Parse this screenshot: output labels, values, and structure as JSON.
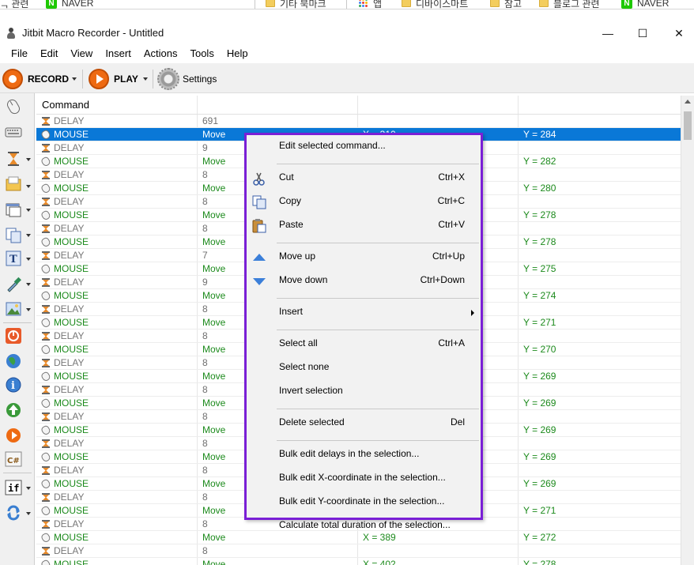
{
  "bookmarks": {
    "left": [
      {
        "label": "ᆨ 관련",
        "type": "text"
      },
      {
        "label": "NAVER",
        "type": "naver"
      },
      {
        "label": "기타 북마크",
        "type": "folder"
      }
    ],
    "right": [
      {
        "label": "앱",
        "type": "apps"
      },
      {
        "label": "디바이스마트",
        "type": "folder"
      },
      {
        "label": "참고",
        "type": "folder"
      },
      {
        "label": "블로그 관련",
        "type": "folder"
      },
      {
        "label": "NAVER",
        "type": "naver"
      }
    ]
  },
  "window": {
    "title": "Jitbit Macro Recorder - Untitled",
    "minimize": "—",
    "maximize": "☐",
    "close": "✕"
  },
  "menu": [
    "File",
    "Edit",
    "View",
    "Insert",
    "Actions",
    "Tools",
    "Help"
  ],
  "toolbar": {
    "record_label": "RECORD",
    "play_label": "PLAY",
    "settings_label": "Settings"
  },
  "grid": {
    "header": "Command",
    "rows": [
      {
        "type": "DELAY",
        "c1": "691",
        "c2": "",
        "c3": ""
      },
      {
        "type": "MOUSE",
        "c1": "Move",
        "c2": "X = 310",
        "c3": "Y = 284",
        "selected": true
      },
      {
        "type": "DELAY",
        "c1": "9",
        "c2": "",
        "c3": ""
      },
      {
        "type": "MOUSE",
        "c1": "Move",
        "c2": "",
        "c3": "Y = 282"
      },
      {
        "type": "DELAY",
        "c1": "8",
        "c2": "",
        "c3": ""
      },
      {
        "type": "MOUSE",
        "c1": "Move",
        "c2": "",
        "c3": "Y = 280"
      },
      {
        "type": "DELAY",
        "c1": "8",
        "c2": "",
        "c3": ""
      },
      {
        "type": "MOUSE",
        "c1": "Move",
        "c2": "",
        "c3": "Y = 278"
      },
      {
        "type": "DELAY",
        "c1": "8",
        "c2": "",
        "c3": ""
      },
      {
        "type": "MOUSE",
        "c1": "Move",
        "c2": "",
        "c3": "Y = 278"
      },
      {
        "type": "DELAY",
        "c1": "7",
        "c2": "",
        "c3": ""
      },
      {
        "type": "MOUSE",
        "c1": "Move",
        "c2": "",
        "c3": "Y = 275"
      },
      {
        "type": "DELAY",
        "c1": "9",
        "c2": "",
        "c3": ""
      },
      {
        "type": "MOUSE",
        "c1": "Move",
        "c2": "",
        "c3": "Y = 274"
      },
      {
        "type": "DELAY",
        "c1": "8",
        "c2": "",
        "c3": ""
      },
      {
        "type": "MOUSE",
        "c1": "Move",
        "c2": "",
        "c3": "Y = 271"
      },
      {
        "type": "DELAY",
        "c1": "8",
        "c2": "",
        "c3": ""
      },
      {
        "type": "MOUSE",
        "c1": "Move",
        "c2": "",
        "c3": "Y = 270"
      },
      {
        "type": "DELAY",
        "c1": "8",
        "c2": "",
        "c3": ""
      },
      {
        "type": "MOUSE",
        "c1": "Move",
        "c2": "",
        "c3": "Y = 269"
      },
      {
        "type": "DELAY",
        "c1": "8",
        "c2": "",
        "c3": ""
      },
      {
        "type": "MOUSE",
        "c1": "Move",
        "c2": "",
        "c3": "Y = 269"
      },
      {
        "type": "DELAY",
        "c1": "8",
        "c2": "",
        "c3": ""
      },
      {
        "type": "MOUSE",
        "c1": "Move",
        "c2": "",
        "c3": "Y = 269"
      },
      {
        "type": "DELAY",
        "c1": "8",
        "c2": "",
        "c3": ""
      },
      {
        "type": "MOUSE",
        "c1": "Move",
        "c2": "",
        "c3": "Y = 269"
      },
      {
        "type": "DELAY",
        "c1": "8",
        "c2": "",
        "c3": ""
      },
      {
        "type": "MOUSE",
        "c1": "Move",
        "c2": "",
        "c3": "Y = 269"
      },
      {
        "type": "DELAY",
        "c1": "8",
        "c2": "",
        "c3": ""
      },
      {
        "type": "MOUSE",
        "c1": "Move",
        "c2": "",
        "c3": "Y = 271"
      },
      {
        "type": "DELAY",
        "c1": "8",
        "c2": "",
        "c3": ""
      },
      {
        "type": "MOUSE",
        "c1": "Move",
        "c2": "X = 389",
        "c3": "Y = 272"
      },
      {
        "type": "DELAY",
        "c1": "8",
        "c2": "",
        "c3": ""
      },
      {
        "type": "MOUSE",
        "c1": "Move",
        "c2": "X = 402",
        "c3": "Y = 278"
      }
    ]
  },
  "context_menu": {
    "items": [
      {
        "label": "Edit selected command...",
        "shortcut": "",
        "icon": ""
      },
      {
        "sep": true
      },
      {
        "label": "Cut",
        "shortcut": "Ctrl+X",
        "icon": "cut"
      },
      {
        "label": "Copy",
        "shortcut": "Ctrl+C",
        "icon": "copy"
      },
      {
        "label": "Paste",
        "shortcut": "Ctrl+V",
        "icon": "paste"
      },
      {
        "sep": true
      },
      {
        "label": "Move up",
        "shortcut": "Ctrl+Up",
        "icon": "up"
      },
      {
        "label": "Move down",
        "shortcut": "Ctrl+Down",
        "icon": "down"
      },
      {
        "sep": true
      },
      {
        "label": "Insert",
        "shortcut": "",
        "icon": "",
        "submenu": true
      },
      {
        "sep": true
      },
      {
        "label": "Select all",
        "shortcut": "Ctrl+A",
        "icon": ""
      },
      {
        "label": "Select none",
        "shortcut": "",
        "icon": ""
      },
      {
        "label": "Invert selection",
        "shortcut": "",
        "icon": ""
      },
      {
        "sep": true
      },
      {
        "label": "Delete selected",
        "shortcut": "Del",
        "icon": ""
      },
      {
        "sep": true
      },
      {
        "label": "Bulk edit delays in the selection...",
        "shortcut": "",
        "icon": ""
      },
      {
        "label": "Bulk edit X-coordinate in the selection...",
        "shortcut": "",
        "icon": ""
      },
      {
        "label": "Bulk edit Y-coordinate in the selection...",
        "shortcut": "",
        "icon": ""
      },
      {
        "label": "Calculate total duration of the selection...",
        "shortcut": "",
        "icon": ""
      }
    ]
  },
  "colors": {
    "accent_selection": "#0a78d7",
    "context_border": "#7a1fd6",
    "record_orange": "#ee6a12",
    "mouse_text_green": "#1c8a1c"
  }
}
